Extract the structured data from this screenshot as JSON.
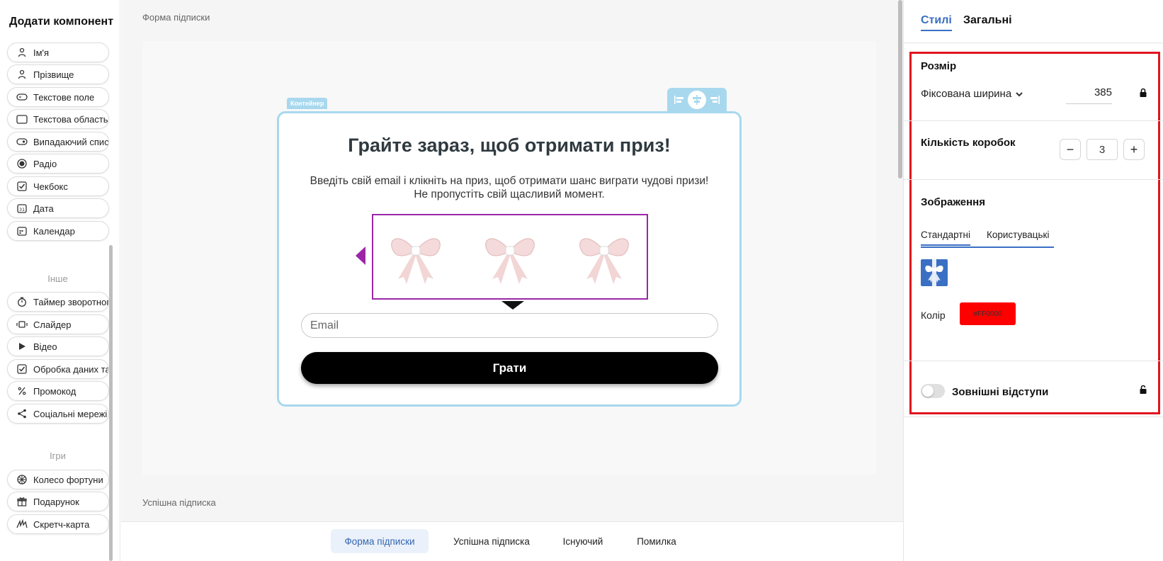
{
  "sidebar": {
    "title": "Додати компонент",
    "components": [
      {
        "label": "Ім'я",
        "icon": "person-icon"
      },
      {
        "label": "Прізвище",
        "icon": "person-icon"
      },
      {
        "label": "Текстове поле",
        "icon": "text-field-icon"
      },
      {
        "label": "Текстова область",
        "icon": "text-area-icon"
      },
      {
        "label": "Випадаючий список",
        "icon": "dropdown-icon"
      },
      {
        "label": "Радіо",
        "icon": "radio-icon"
      },
      {
        "label": "Чекбокс",
        "icon": "checkbox-icon"
      },
      {
        "label": "Дата",
        "icon": "date-icon"
      },
      {
        "label": "Календар",
        "icon": "calendar-icon"
      }
    ],
    "other_label": "Інше",
    "other": [
      {
        "label": "Таймер зворотного відліку",
        "icon": "timer-icon"
      },
      {
        "label": "Слайдер",
        "icon": "slider-icon"
      },
      {
        "label": "Відео",
        "icon": "play-icon"
      },
      {
        "label": "Обробка даних та",
        "icon": "checkbox-icon"
      },
      {
        "label": "Промокод",
        "icon": "percent-icon"
      },
      {
        "label": "Соціальні мережі",
        "icon": "share-icon"
      }
    ],
    "games_label": "Ігри",
    "games": [
      {
        "label": "Колесо фортуни",
        "icon": "wheel-icon"
      },
      {
        "label": "Подарунок",
        "icon": "gift-icon"
      },
      {
        "label": "Скретч-карта",
        "icon": "scratch-icon"
      }
    ]
  },
  "canvas": {
    "form_label": "Форма підписки",
    "success_label": "Успішна підписка",
    "container_tag": "Контейнер",
    "form": {
      "title": "Грайте зараз, щоб отримати приз!",
      "description": "Введіть свій email і клікніть на приз, щоб отримати шанс виграти чудові призи! Не пропустіть свій щасливий момент.",
      "email_placeholder": "Email",
      "button_label": "Грати",
      "gift_count": 3,
      "gift_color": "#FF0000"
    },
    "bottom_tabs": [
      {
        "label": "Форма підписки",
        "active": true
      },
      {
        "label": "Успішна підписка",
        "active": false
      },
      {
        "label": "Існуючий",
        "active": false
      },
      {
        "label": "Помилка",
        "active": false
      }
    ]
  },
  "panel": {
    "tabs": [
      {
        "label": "Стилі",
        "active": true
      },
      {
        "label": "Загальні",
        "active": false
      }
    ],
    "size": {
      "title": "Розмір",
      "mode": "Фіксована ширина",
      "width": "385"
    },
    "boxes": {
      "title": "Кількість коробок",
      "minus": "−",
      "value": "3",
      "plus": "+"
    },
    "images": {
      "title": "Зображення",
      "tabs": [
        {
          "label": "Стандартні",
          "active": true
        },
        {
          "label": "Користувацькі",
          "active": false
        }
      ],
      "color_label": "Колір",
      "color_value": "#FF0000"
    },
    "margins": {
      "title": "Зовнішні відступи",
      "enabled": false
    },
    "accent_color": "#3A6FC4",
    "highlight_color": "#E0141E"
  }
}
